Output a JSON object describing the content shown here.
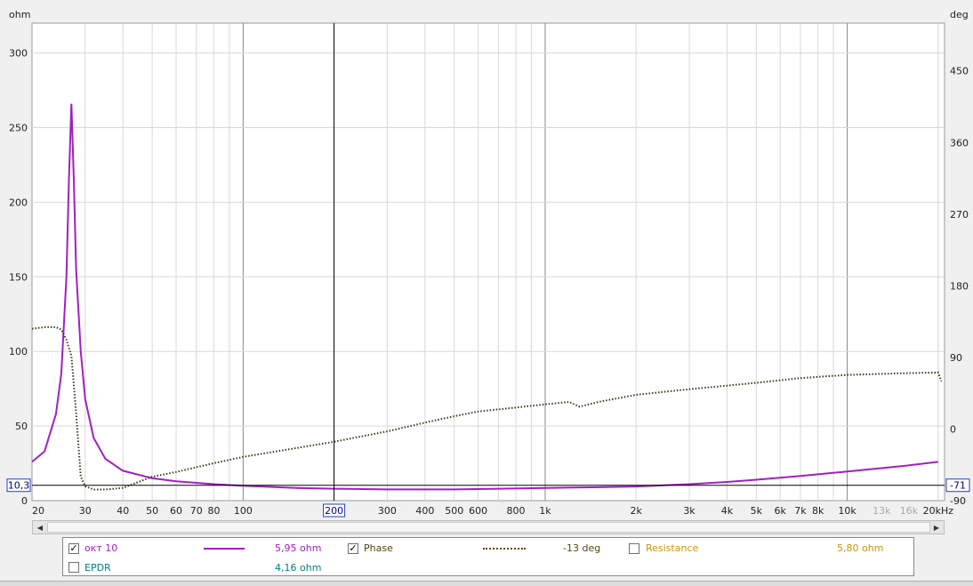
{
  "chart_data": {
    "type": "line",
    "x_scale": "log",
    "xlim": [
      20,
      21000
    ],
    "ylim_left": [
      0,
      320
    ],
    "ylim_right": [
      -90,
      510
    ],
    "y_left_unit": "ohm",
    "y_right_unit": "deg",
    "x_unit_suffix": "Hz",
    "grid": true,
    "x_ticks": [
      {
        "v": 20,
        "label": "20"
      },
      {
        "v": 30,
        "label": "30"
      },
      {
        "v": 40,
        "label": "40"
      },
      {
        "v": 50,
        "label": "50"
      },
      {
        "v": 60,
        "label": "60"
      },
      {
        "v": 70,
        "label": "70"
      },
      {
        "v": 80,
        "label": "80"
      },
      {
        "v": 100,
        "label": "100"
      },
      {
        "v": 200,
        "label": "200"
      },
      {
        "v": 300,
        "label": "300"
      },
      {
        "v": 400,
        "label": "400"
      },
      {
        "v": 500,
        "label": "500"
      },
      {
        "v": 600,
        "label": "600"
      },
      {
        "v": 800,
        "label": "800"
      },
      {
        "v": 1000,
        "label": "1k"
      },
      {
        "v": 2000,
        "label": "2k"
      },
      {
        "v": 3000,
        "label": "3k"
      },
      {
        "v": 4000,
        "label": "4k"
      },
      {
        "v": 5000,
        "label": "5k"
      },
      {
        "v": 6000,
        "label": "6k"
      },
      {
        "v": 7000,
        "label": "7k"
      },
      {
        "v": 8000,
        "label": "8k"
      },
      {
        "v": 10000,
        "label": "10k"
      },
      {
        "v": 13000,
        "label": "13k",
        "faint": true
      },
      {
        "v": 16000,
        "label": "16k",
        "faint": true
      },
      {
        "v": 20000,
        "label": "20kHz"
      }
    ],
    "y_left_ticks": [
      0,
      50,
      100,
      150,
      200,
      250,
      300
    ],
    "y_right_ticks": [
      -90,
      0,
      90,
      180,
      270,
      360,
      450
    ],
    "cursor": {
      "x": 200,
      "y": 10.3,
      "x_label": "200",
      "y_label": "10,3",
      "y_right_label": "-71"
    },
    "series": [
      {
        "name": "окт 10",
        "axis": "left",
        "color": "#a020c0",
        "style": "solid",
        "points": [
          [
            20,
            26
          ],
          [
            22,
            33
          ],
          [
            24,
            58
          ],
          [
            25,
            85
          ],
          [
            26,
            150
          ],
          [
            26.5,
            215
          ],
          [
            27,
            266
          ],
          [
            27.5,
            215
          ],
          [
            28,
            155
          ],
          [
            29,
            100
          ],
          [
            30,
            68
          ],
          [
            32,
            42
          ],
          [
            35,
            28
          ],
          [
            40,
            20
          ],
          [
            50,
            15
          ],
          [
            60,
            13
          ],
          [
            80,
            11
          ],
          [
            100,
            10
          ],
          [
            150,
            8.5
          ],
          [
            200,
            8
          ],
          [
            300,
            7.5
          ],
          [
            500,
            7.5
          ],
          [
            700,
            8
          ],
          [
            1000,
            8.5
          ],
          [
            1500,
            9
          ],
          [
            2000,
            9.5
          ],
          [
            3000,
            11
          ],
          [
            4000,
            12.5
          ],
          [
            5000,
            14
          ],
          [
            7000,
            16.5
          ],
          [
            10000,
            19.5
          ],
          [
            15000,
            23
          ],
          [
            20000,
            26
          ]
        ]
      },
      {
        "name": "Phase",
        "axis": "right",
        "color": "#3a3a1a",
        "style": "dotted",
        "points": [
          [
            20,
            126
          ],
          [
            22,
            128
          ],
          [
            24,
            128
          ],
          [
            25,
            125
          ],
          [
            26,
            112
          ],
          [
            27,
            92
          ],
          [
            28,
            20
          ],
          [
            29,
            -60
          ],
          [
            30,
            -72
          ],
          [
            32,
            -76
          ],
          [
            35,
            -76
          ],
          [
            40,
            -74
          ],
          [
            50,
            -60
          ],
          [
            60,
            -54
          ],
          [
            80,
            -43
          ],
          [
            100,
            -35
          ],
          [
            150,
            -24
          ],
          [
            200,
            -16
          ],
          [
            300,
            -3
          ],
          [
            400,
            8
          ],
          [
            500,
            16
          ],
          [
            600,
            22
          ],
          [
            800,
            27
          ],
          [
            1000,
            31
          ],
          [
            1200,
            34
          ],
          [
            1300,
            28
          ],
          [
            1500,
            34
          ],
          [
            2000,
            43
          ],
          [
            3000,
            50
          ],
          [
            5000,
            58
          ],
          [
            7000,
            64
          ],
          [
            10000,
            68
          ],
          [
            15000,
            70
          ],
          [
            20000,
            71
          ],
          [
            20500,
            60
          ]
        ]
      }
    ]
  },
  "legend": {
    "row1": [
      {
        "checked": true,
        "label": "окт 10",
        "value": "5,95 ohm",
        "color": "#a020c0",
        "line": "solid"
      },
      {
        "checked": true,
        "label": "Phase",
        "value": "-13 deg",
        "color": "#5a4a10",
        "line": "dotted"
      },
      {
        "checked": false,
        "label": "Resistance",
        "value": "5,80 ohm",
        "color": "#c8960a"
      }
    ],
    "row2": [
      {
        "checked": false,
        "label": "EPDR",
        "value": "4,16 ohm",
        "color": "#008080"
      }
    ]
  },
  "scrollbar": {
    "left_arrow": "◀",
    "right_arrow": "▶"
  },
  "check_glyph": "✓",
  "colors": {
    "plot_bg": "#ffffff",
    "grid": "#d8d8d8",
    "grid_major": "#888888",
    "cursor": "#000000"
  }
}
